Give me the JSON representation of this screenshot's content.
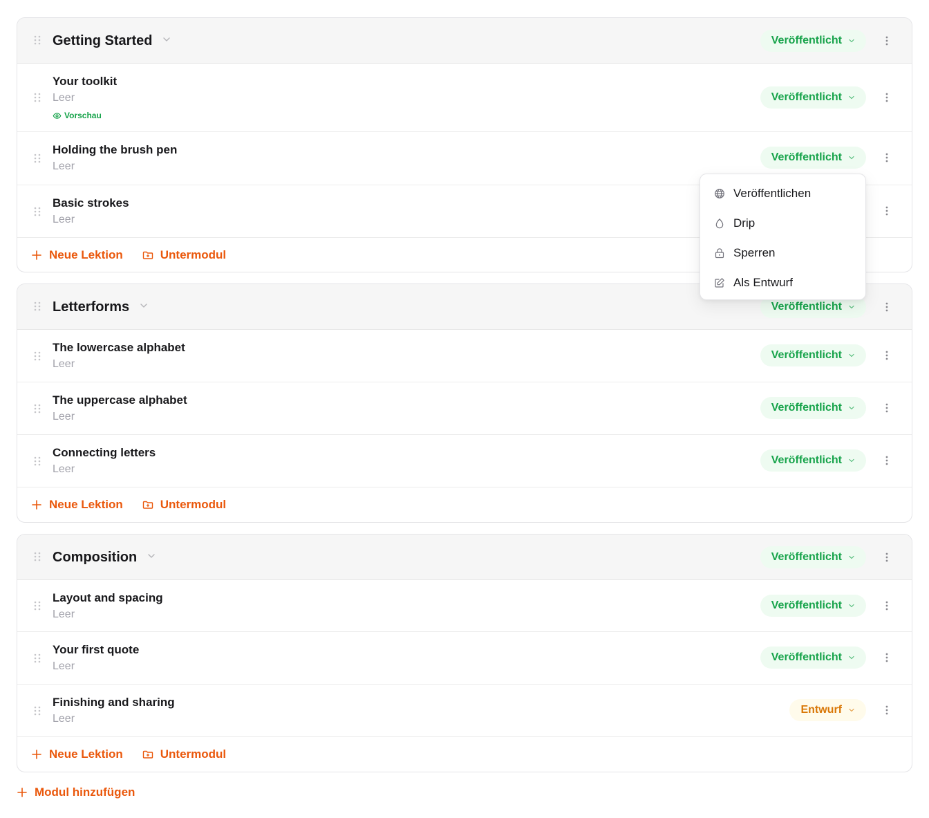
{
  "colors": {
    "accent": "#ea580c",
    "published_text": "#16a34a",
    "published_bg": "#eefbf1",
    "draft_text": "#d97706",
    "draft_bg": "#fffbeb"
  },
  "labels": {
    "published": "Veröffentlicht",
    "draft": "Entwurf",
    "empty": "Leer",
    "preview": "Vorschau",
    "new_lesson": "Neue Lektion",
    "submodule": "Untermodul",
    "add_module": "Modul hinzufügen"
  },
  "modules": [
    {
      "title": "Getting Started",
      "status": "Veröffentlicht",
      "lessons": [
        {
          "title": "Your toolkit",
          "subtitle": "Leer",
          "status": "Veröffentlicht",
          "preview": "Vorschau"
        },
        {
          "title": "Holding the brush pen",
          "subtitle": "Leer",
          "status": "Veröffentlicht"
        },
        {
          "title": "Basic strokes",
          "subtitle": "Leer",
          "status": ""
        }
      ]
    },
    {
      "title": "Letterforms",
      "status": "Veröffentlicht",
      "lessons": [
        {
          "title": "The lowercase alphabet",
          "subtitle": "Leer",
          "status": "Veröffentlicht"
        },
        {
          "title": "The uppercase alphabet",
          "subtitle": "Leer",
          "status": "Veröffentlicht"
        },
        {
          "title": "Connecting letters",
          "subtitle": "Leer",
          "status": "Veröffentlicht"
        }
      ]
    },
    {
      "title": "Composition",
      "status": "Veröffentlicht",
      "lessons": [
        {
          "title": "Layout and spacing",
          "subtitle": "Leer",
          "status": "Veröffentlicht"
        },
        {
          "title": "Your first quote",
          "subtitle": "Leer",
          "status": "Veröffentlicht"
        },
        {
          "title": "Finishing and sharing",
          "subtitle": "Leer",
          "status": "Entwurf"
        }
      ]
    }
  ],
  "status_menu": {
    "items": [
      {
        "label": "Veröffentlichen",
        "icon": "globe-icon"
      },
      {
        "label": "Drip",
        "icon": "droplet-icon"
      },
      {
        "label": "Sperren",
        "icon": "lock-icon"
      },
      {
        "label": "Als Entwurf",
        "icon": "edit-icon"
      }
    ]
  }
}
